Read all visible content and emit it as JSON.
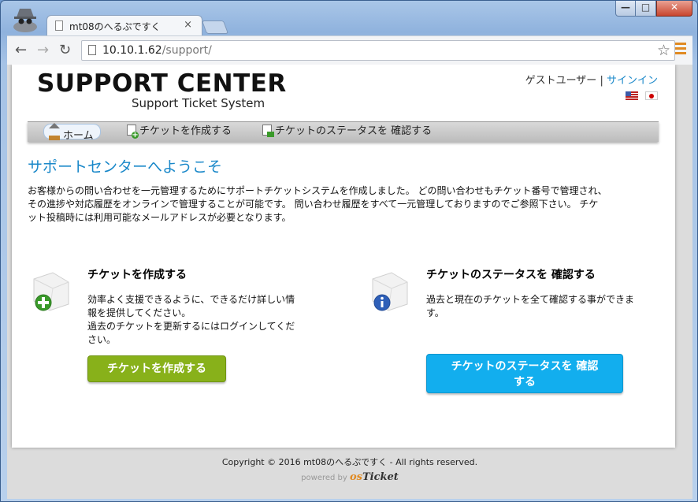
{
  "browser": {
    "tab_title": "mt08のへるぷですく",
    "url_host": "10.10.1.62",
    "url_path": "/support/",
    "window_controls": {
      "minimize": "—",
      "maximize": "□",
      "close": "✕"
    }
  },
  "header": {
    "logo_main": "SUPPORT CENTER",
    "logo_sub": "Support Ticket System",
    "guest_user": "ゲストユーザー",
    "separator": "|",
    "sign_in": "サインイン",
    "languages": [
      "en-us-flag",
      "ja-flag"
    ]
  },
  "nav": {
    "items": [
      {
        "label": "ホーム",
        "icon": "home-icon"
      },
      {
        "label": "チケットを作成する",
        "icon": "document-add-icon"
      },
      {
        "label": "チケットのステータスを 確認する",
        "icon": "document-status-icon"
      }
    ]
  },
  "main": {
    "title": "サポートセンターへようこそ",
    "intro_line1": "お客様からの問い合わせを一元管理するためにサポートチケットシステムを作成しました。 どの問い合わせもチケット番号で管理され、",
    "intro_line2": "その進捗や対応履歴をオンラインで管理することが可能です。 問い合わせ履歴をすべて一元管理しておりますのでご参照下さい。 チケ",
    "intro_line3": "ット投稿時には利用可能なメールアドレスが必要となります。",
    "open_ticket": {
      "heading": "チケットを作成する",
      "desc_line1": "効率よく支援できるように、できるだけ詳しい情",
      "desc_line2": "報を提供してください。",
      "desc_line3": "過去のチケットを更新するにはログインしてくだ",
      "desc_line4": "さい。",
      "button": "チケットを作成する"
    },
    "check_status": {
      "heading": "チケットのステータスを 確認する",
      "desc_line1": "過去と現在のチケットを全て確認する事ができま",
      "desc_line2": "す。",
      "button_line1": "チケットのステータスを 確認",
      "button_line2": "する"
    }
  },
  "footer": {
    "copyright": "Copyright © 2016 mt08のへるぷですく - All rights reserved.",
    "powered_by": "powered by",
    "brand_os": "os",
    "brand_ticket": "Ticket"
  },
  "colors": {
    "link": "#1a88c9",
    "green_button": "#88b11a",
    "blue_button": "#12aeee",
    "brand_orange": "#e08a22"
  }
}
